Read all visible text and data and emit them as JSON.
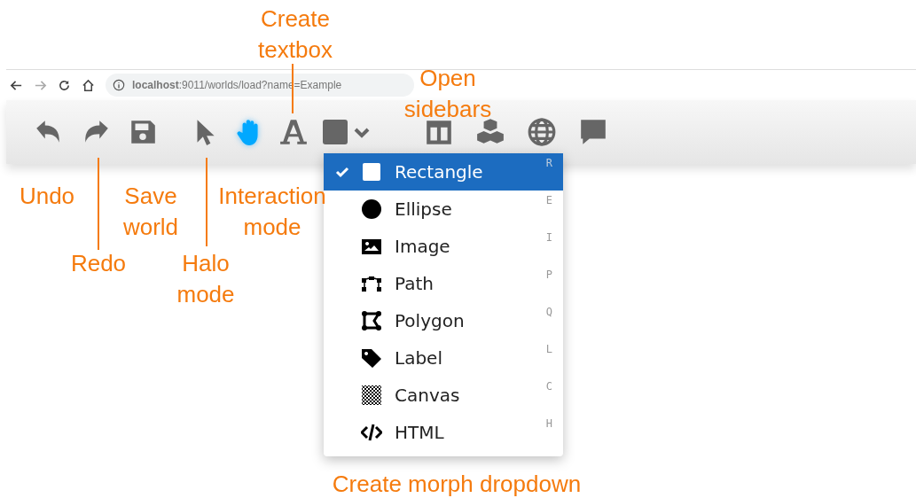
{
  "browser": {
    "url": "**localhost**:9011/worlds/load?name=Example"
  },
  "toolbar": {
    "groups": [
      {
        "tools": [
          {
            "kind": "undo",
            "selected": false
          },
          {
            "kind": "redo",
            "selected": false
          },
          {
            "kind": "save",
            "selected": false
          }
        ]
      },
      {
        "tools": [
          {
            "kind": "cursor",
            "selected": false
          },
          {
            "kind": "hand",
            "selected": true
          },
          {
            "kind": "text",
            "selected": false
          },
          {
            "kind": "shape",
            "selected": false
          }
        ]
      },
      {
        "tools": [
          {
            "kind": "sidebar",
            "selected": false
          },
          {
            "kind": "cubes",
            "selected": false
          },
          {
            "kind": "globe",
            "selected": false
          },
          {
            "kind": "chat",
            "selected": false
          }
        ]
      }
    ]
  },
  "dropdown": {
    "items": [
      {
        "kind": "rectangle",
        "label": "Rectangle",
        "shortcut": "R",
        "selected": true
      },
      {
        "kind": "ellipse",
        "label": "Ellipse",
        "shortcut": "E",
        "selected": false
      },
      {
        "kind": "image",
        "label": "Image",
        "shortcut": "I",
        "selected": false
      },
      {
        "kind": "path",
        "label": "Path",
        "shortcut": "P",
        "selected": false
      },
      {
        "kind": "polygon",
        "label": "Polygon",
        "shortcut": "Q",
        "selected": false
      },
      {
        "kind": "label",
        "label": "Label",
        "shortcut": "L",
        "selected": false
      },
      {
        "kind": "canvas",
        "label": "Canvas",
        "shortcut": "C",
        "selected": false
      },
      {
        "kind": "html",
        "label": "HTML",
        "shortcut": "H",
        "selected": false
      }
    ]
  },
  "annotations": [
    {
      "text": "Create textbox"
    },
    {
      "text": "Open sidebars"
    },
    {
      "text": "Undo"
    },
    {
      "text": "Redo"
    },
    {
      "text": "Save world"
    },
    {
      "text": "Halo mode"
    },
    {
      "text": "Interaction mode"
    },
    {
      "text": "Create morph dropdown"
    }
  ]
}
